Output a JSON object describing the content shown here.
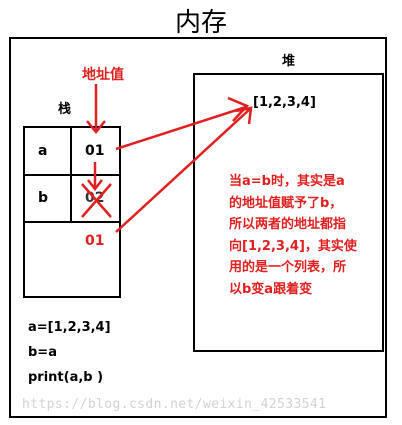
{
  "title": "内存",
  "heap": {
    "label": "堆",
    "value": "[1,2,3,4]",
    "note_lines": [
      "当a=b时，其实是a",
      "的地址值赋予了b，",
      "所以两者的地址都指",
      "向[1,2,3,4]，其实使",
      "用的是一个列表，所",
      "以b变a跟着变"
    ]
  },
  "stack": {
    "label": "栈",
    "address_label": "地址值",
    "rows": [
      {
        "name": "a",
        "address": "01"
      },
      {
        "name": "b",
        "address": "02",
        "new_address": "01"
      }
    ]
  },
  "code_lines": [
    "a=[1,2,3,4]",
    "b=a",
    "print(a,b )"
  ],
  "watermark": "https://blog.csdn.net/weixin_42533541",
  "colors": {
    "annotation": "#e02020",
    "border": "#000000"
  }
}
